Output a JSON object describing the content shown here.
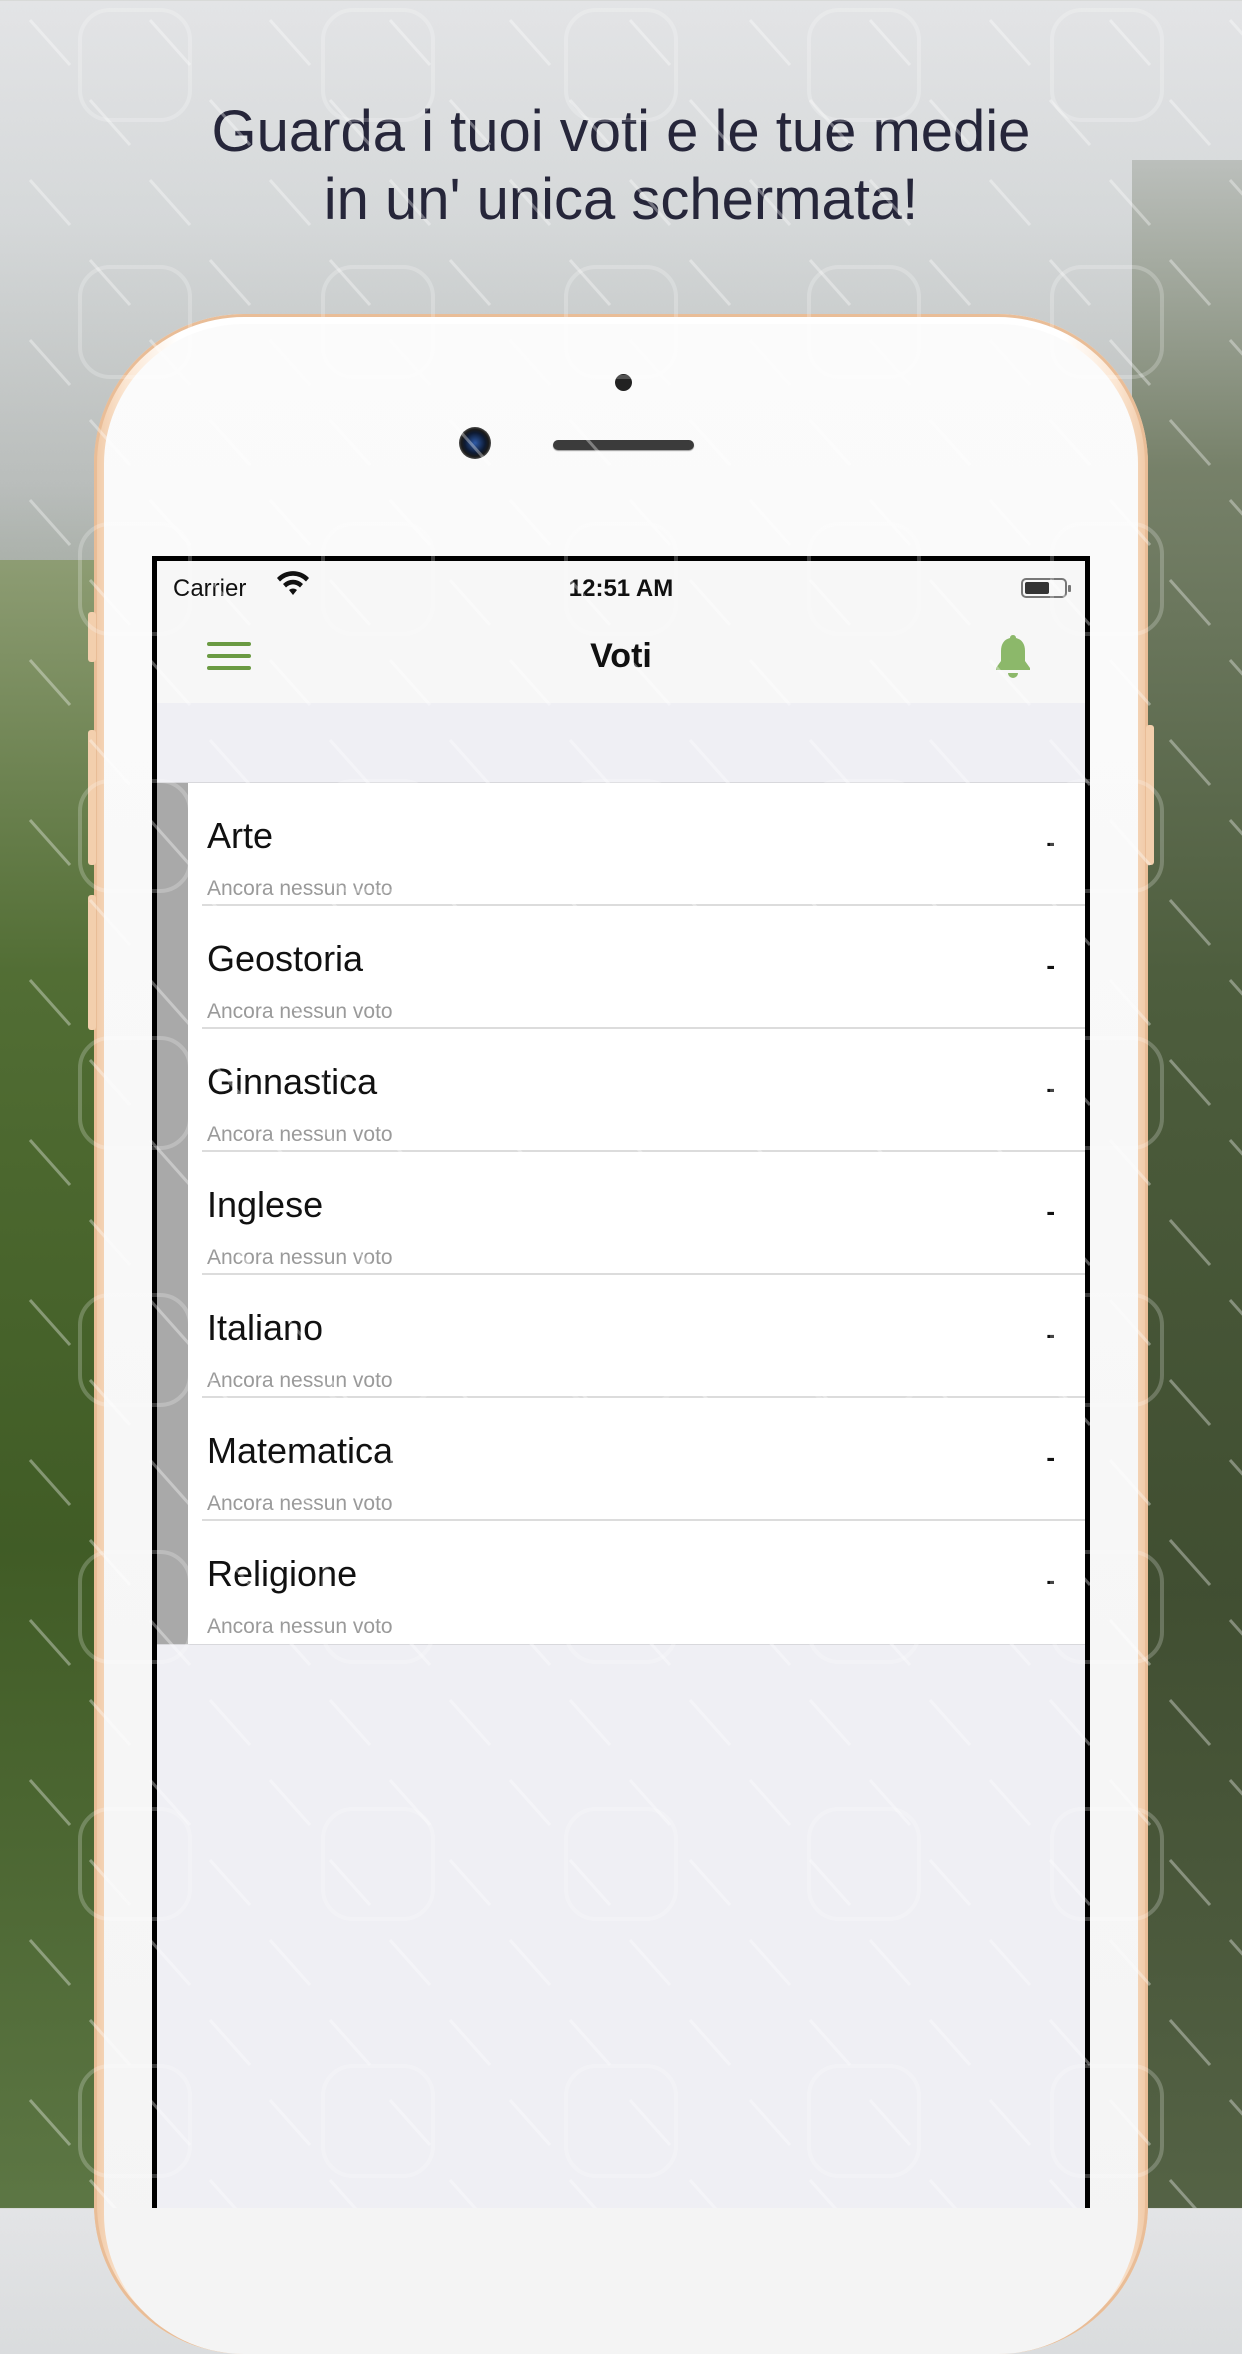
{
  "headline": {
    "line1": "Guarda i tuoi voti e le tue medie",
    "line2": "in un' unica schermata!"
  },
  "status_bar": {
    "carrier": "Carrier",
    "time": "12:51 AM"
  },
  "navbar": {
    "title": "Voti",
    "menu_icon": "hamburger-menu-icon",
    "notification_icon": "bell-icon",
    "accent_color": "#6a9a42"
  },
  "subjects": [
    {
      "name": "Arte",
      "subtitle": "Ancora nessun voto",
      "average": "-"
    },
    {
      "name": "Geostoria",
      "subtitle": "Ancora nessun voto",
      "average": "-"
    },
    {
      "name": "Ginnastica",
      "subtitle": "Ancora nessun voto",
      "average": "-"
    },
    {
      "name": "Inglese",
      "subtitle": "Ancora nessun voto",
      "average": "-"
    },
    {
      "name": "Italiano",
      "subtitle": "Ancora nessun voto",
      "average": "-"
    },
    {
      "name": "Matematica",
      "subtitle": "Ancora nessun voto",
      "average": "-"
    },
    {
      "name": "Religione",
      "subtitle": "Ancora nessun voto",
      "average": "-"
    }
  ]
}
